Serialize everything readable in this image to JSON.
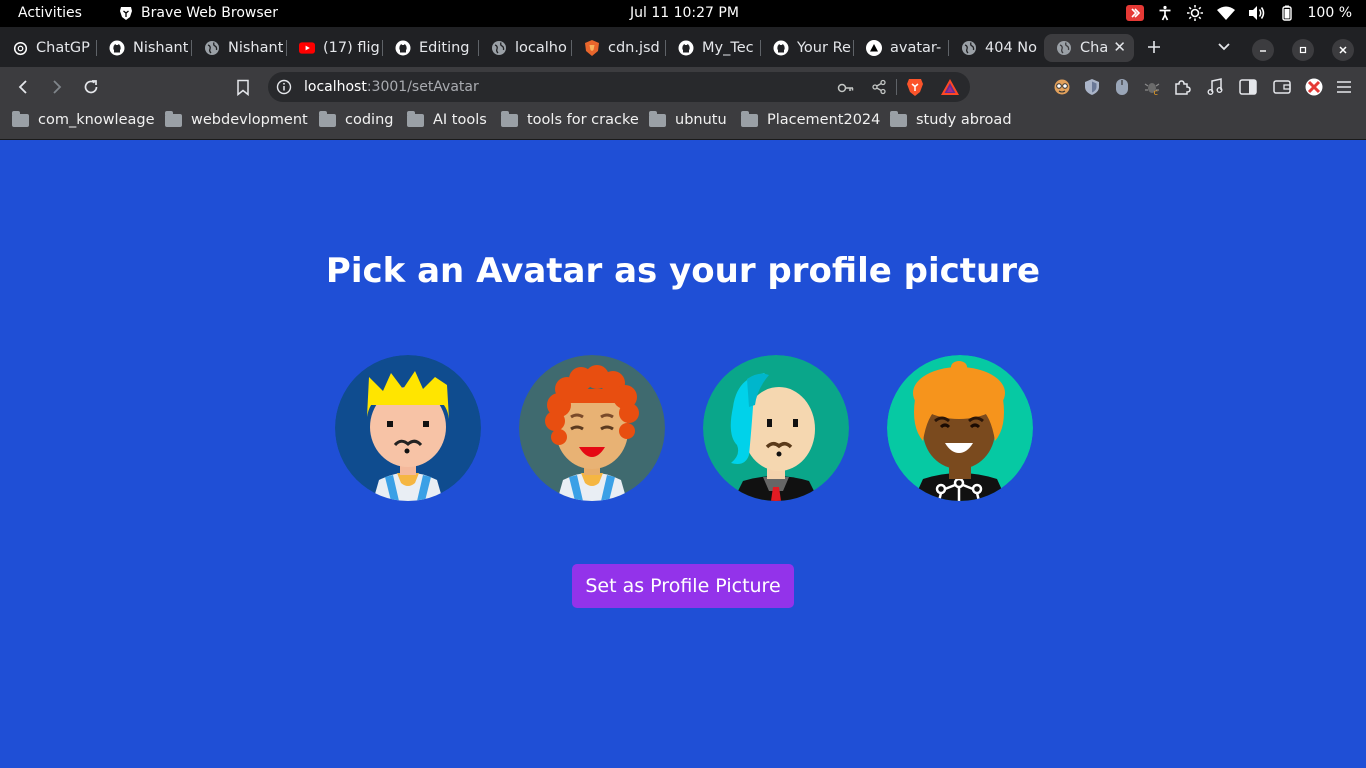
{
  "system": {
    "activities": "Activities",
    "app_name": "Brave Web Browser",
    "clock": "Jul 11  10:27 PM",
    "battery": "100 %"
  },
  "tabs": [
    {
      "title": "ChatGP",
      "icon": "chatgpt-icon"
    },
    {
      "title": "Nishant",
      "icon": "github-icon"
    },
    {
      "title": "Nishant",
      "icon": "globe-icon"
    },
    {
      "title": "(17) flig",
      "icon": "youtube-icon"
    },
    {
      "title": "Editing",
      "icon": "github-icon"
    },
    {
      "title": "localho",
      "icon": "globe-icon"
    },
    {
      "title": "cdn.jsd",
      "icon": "shield-icon"
    },
    {
      "title": "My_Tec",
      "icon": "github-icon"
    },
    {
      "title": "Your Re",
      "icon": "github-icon"
    },
    {
      "title": "avatar-",
      "icon": "vercel-icon"
    },
    {
      "title": "404 No",
      "icon": "globe-icon"
    },
    {
      "title": "Cha",
      "icon": "globe-icon"
    }
  ],
  "address_bar": {
    "host": "localhost",
    "path": ":3001/setAvatar"
  },
  "bookmarks": [
    "com_knowleage",
    "webdevlopment",
    "coding",
    "AI tools",
    "tools for cracke",
    "ubnutu",
    "Placement2024",
    "study abroad"
  ],
  "page": {
    "title": "Pick an Avatar as your profile picture",
    "button_label": "Set as Profile Picture",
    "avatars": [
      {
        "name": "avatar-1",
        "bg": "#0f4c8f"
      },
      {
        "name": "avatar-2",
        "bg": "#3f6a6f"
      },
      {
        "name": "avatar-3",
        "bg": "#0aa68a"
      },
      {
        "name": "avatar-4",
        "bg": "#06c9a3"
      }
    ]
  },
  "colors": {
    "page_bg": "#1f4fd6",
    "button_bg": "#9333ea",
    "chrome_dark": "#202124",
    "chrome_toolbar": "#3c3c3f"
  }
}
